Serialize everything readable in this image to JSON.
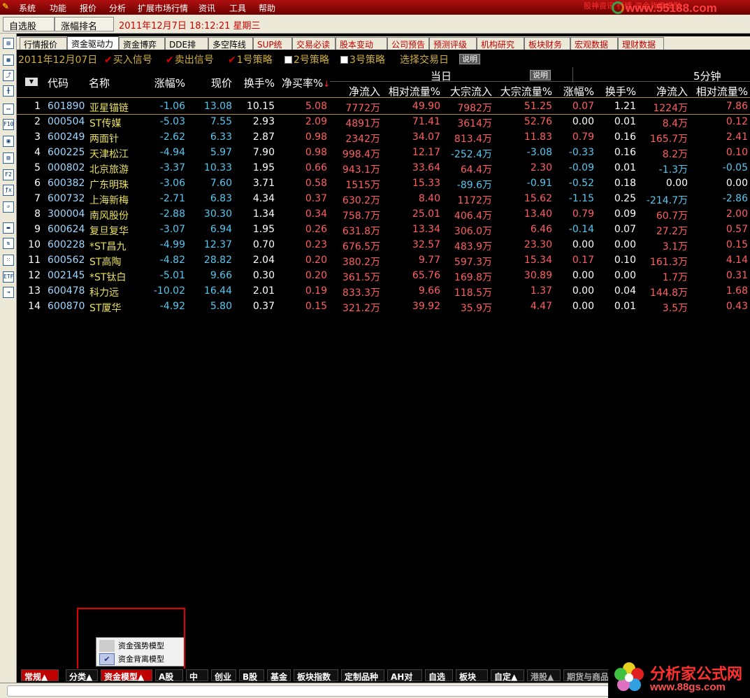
{
  "menubar": {
    "items": [
      "系统",
      "功能",
      "报价",
      "分析",
      "扩展市场行情",
      "资讯",
      "工具",
      "帮助"
    ],
    "watermark": "股神资讯 行情 资金背离模型",
    "site": "www.55188.com"
  },
  "toolbar": {
    "btn1": "自选股",
    "btn2": "涨幅排名",
    "datetime": "2011年12月7日  18:12:21 星期三"
  },
  "tabs": [
    {
      "label": "行情报价",
      "active": false,
      "red": false
    },
    {
      "label": "资金驱动力",
      "active": true,
      "red": false
    },
    {
      "label": "资金博弈",
      "active": false,
      "red": false
    },
    {
      "label": "DDE排名",
      "active": false,
      "red": false
    },
    {
      "label": "多空阵线",
      "active": false,
      "red": false
    },
    {
      "label": "SUP统计",
      "active": false,
      "red": true
    },
    {
      "label": "交易必读",
      "active": false,
      "red": true
    },
    {
      "label": "股本变动",
      "active": false,
      "red": true
    },
    {
      "label": "公司预告",
      "active": false,
      "red": true
    },
    {
      "label": "预测评级",
      "active": false,
      "red": true
    },
    {
      "label": "机构研究",
      "active": false,
      "red": true
    },
    {
      "label": "板块财务",
      "active": false,
      "red": true
    },
    {
      "label": "宏观数据",
      "active": false,
      "red": true
    },
    {
      "label": "理财数据",
      "active": false,
      "red": true
    }
  ],
  "filter": {
    "date": "2011年12月07日",
    "buy": "买入信号",
    "sell": "卖出信号",
    "s1": "1号策略",
    "s2": "2号策略",
    "s3": "3号策略",
    "choose": "选择交易日",
    "help": "说明"
  },
  "headers": {
    "group1": "当日",
    "group1_help": "说明",
    "group2": "5分钟",
    "code": "代码",
    "name": "名称",
    "change": "涨幅%",
    "price": "现价",
    "turnover": "换手%",
    "netbuy": "净买率%",
    "net_inflow": "净流入",
    "rel_flow": "相对流量%",
    "block_inflow": "大宗流入",
    "block_flow": "大宗流量%",
    "m5_change": "涨幅%",
    "m5_turnover": "换手%",
    "m5_net_inflow": "净流入",
    "m5_rel_flow": "相对流量%"
  },
  "rows": [
    [
      "1",
      "601890",
      "亚星锚链",
      "-1.06",
      "13.08",
      "10.15",
      "5.08",
      "7772万",
      "49.90",
      "7982万",
      "51.25",
      "0.07",
      "1.21",
      "1224万",
      "7.86"
    ],
    [
      "2",
      "000504",
      "ST传媒",
      "-5.03",
      "7.55",
      "2.93",
      "2.09",
      "4891万",
      "71.41",
      "3614万",
      "52.76",
      "0.00",
      "0.01",
      "8.4万",
      "0.12"
    ],
    [
      "3",
      "600249",
      "两面针",
      "-2.62",
      "6.33",
      "2.87",
      "0.98",
      "2342万",
      "34.07",
      "813.4万",
      "11.83",
      "0.79",
      "0.16",
      "165.7万",
      "2.41"
    ],
    [
      "4",
      "600225",
      "天津松江",
      "-4.94",
      "5.97",
      "7.90",
      "0.98",
      "998.4万",
      "12.17",
      "-252.4万",
      "-3.08",
      "-0.33",
      "0.16",
      "8.2万",
      "0.10"
    ],
    [
      "5",
      "000802",
      "北京旅游",
      "-3.37",
      "10.33",
      "1.95",
      "0.66",
      "943.1万",
      "33.64",
      "64.4万",
      "2.30",
      "-0.09",
      "0.01",
      "-1.3万",
      "-0.05"
    ],
    [
      "6",
      "600382",
      "广东明珠",
      "-3.06",
      "7.60",
      "3.71",
      "0.58",
      "1515万",
      "15.33",
      "-89.6万",
      "-0.91",
      "-0.52",
      "0.18",
      "0.00",
      "0.00"
    ],
    [
      "7",
      "600732",
      "上海新梅",
      "-2.71",
      "6.83",
      "4.34",
      "0.37",
      "630.2万",
      "8.40",
      "1172万",
      "15.62",
      "-1.15",
      "0.25",
      "-214.7万",
      "-2.86"
    ],
    [
      "8",
      "300004",
      "南风股份",
      "-2.88",
      "30.30",
      "1.34",
      "0.34",
      "758.7万",
      "25.01",
      "406.4万",
      "13.40",
      "0.79",
      "0.09",
      "60.7万",
      "2.00"
    ],
    [
      "9",
      "600624",
      "复旦复华",
      "-3.07",
      "6.94",
      "1.95",
      "0.26",
      "631.8万",
      "13.34",
      "306.0万",
      "6.46",
      "-0.14",
      "0.07",
      "27.2万",
      "0.57"
    ],
    [
      "10",
      "600228",
      "*ST昌九",
      "-4.99",
      "12.37",
      "0.70",
      "0.23",
      "676.5万",
      "32.57",
      "483.9万",
      "23.30",
      "0.00",
      "0.00",
      "3.1万",
      "0.15"
    ],
    [
      "11",
      "600562",
      "ST高陶",
      "-4.82",
      "28.82",
      "2.04",
      "0.20",
      "380.2万",
      "9.77",
      "597.3万",
      "15.34",
      "0.17",
      "0.10",
      "161.3万",
      "4.14"
    ],
    [
      "12",
      "002145",
      "*ST钛白",
      "-5.01",
      "9.66",
      "0.30",
      "0.20",
      "361.5万",
      "65.76",
      "169.8万",
      "30.89",
      "0.00",
      "0.00",
      "1.7万",
      "0.31"
    ],
    [
      "13",
      "600478",
      "科力远",
      "-10.02",
      "16.44",
      "2.01",
      "0.19",
      "833.3万",
      "9.66",
      "118.5万",
      "1.37",
      "0.00",
      "0.04",
      "144.8万",
      "1.68"
    ],
    [
      "14",
      "600870",
      "ST厦华",
      "-4.92",
      "5.80",
      "0.37",
      "0.15",
      "321.2万",
      "39.92",
      "35.9万",
      "4.47",
      "0.00",
      "0.01",
      "3.5万",
      "0.43"
    ]
  ],
  "bottom_tabs": [
    {
      "label": "常规▲",
      "red": true
    },
    {
      "label": "分类▲",
      "red": false
    },
    {
      "label": "资金模型▲",
      "red": true
    },
    {
      "label": "A股",
      "red": false
    },
    {
      "label": "中小",
      "red": false
    },
    {
      "label": "创业",
      "red": false
    },
    {
      "label": "B股",
      "red": false
    },
    {
      "label": "基金",
      "red": false
    },
    {
      "label": "板块指数",
      "red": false
    },
    {
      "label": "定制品种",
      "red": false
    },
    {
      "label": "AH对照",
      "red": false
    },
    {
      "label": "自选",
      "red": false
    },
    {
      "label": "板块",
      "red": false
    },
    {
      "label": "自定▲",
      "red": false
    },
    {
      "label": "港股▲",
      "red": false,
      "gray": true
    },
    {
      "label": "期货与商品",
      "red": false,
      "gray": true
    }
  ],
  "popup": {
    "item1": "资金强势模型",
    "item2": "资金背离模型",
    "checked": "✔"
  },
  "brand": {
    "title": "分析家公式网",
    "url": "www.88gs.com"
  },
  "colors": {
    "negative": "#58c8f0",
    "positive": "#ff6060",
    "code": "#a0d8ff",
    "name": "#e8e060",
    "menubar": "#9a0a0a"
  },
  "left_icons": [
    "grid-icon",
    "table-icon",
    "line-chart-icon",
    "kline-icon",
    "list-icon",
    "f10-icon",
    "report-icon",
    "news-icon",
    "f2-icon",
    "formula-icon",
    "search-icon",
    "folder-icon",
    "sort-icon",
    "dice-icon",
    "etf-icon",
    "exit-icon"
  ]
}
